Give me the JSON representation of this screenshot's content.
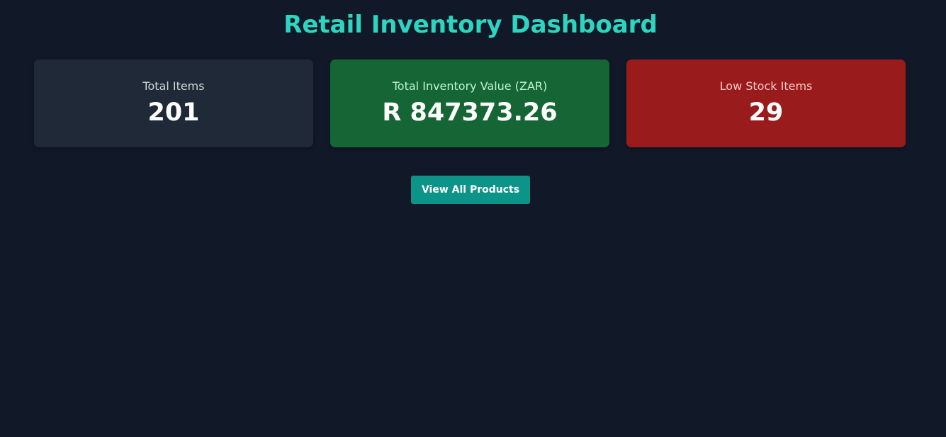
{
  "header": {
    "title": "Retail Inventory Dashboard"
  },
  "stats": {
    "total_items": {
      "label": "Total Items",
      "value": "201"
    },
    "inventory_value": {
      "label": "Total Inventory Value (ZAR)",
      "value": "R 847373.26"
    },
    "low_stock": {
      "label": "Low Stock Items",
      "value": "29"
    }
  },
  "actions": {
    "view_all_label": "View All Products"
  },
  "colors": {
    "background": "#111827",
    "accent": "#2dd4bf",
    "card_neutral": "#1f2937",
    "card_success": "#166534",
    "card_danger": "#991b1b",
    "button": "#0d9488"
  }
}
